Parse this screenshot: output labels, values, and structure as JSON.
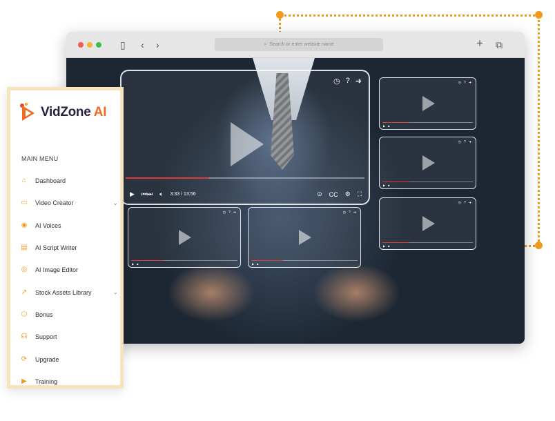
{
  "brand": {
    "name_main": "VidZone",
    "name_accent": "AI",
    "accent_color": "#f26a22"
  },
  "browser": {
    "address_placeholder": "Search or enter website name"
  },
  "player": {
    "time": "3:33 / 13:56",
    "cc": "CC",
    "progress": 0.35
  },
  "sidebar": {
    "section_title": "MAIN MENU",
    "items": [
      {
        "label": "Dashboard",
        "icon": "home-icon",
        "glyph": "⌂",
        "expand": ""
      },
      {
        "label": "Video Creator",
        "icon": "monitor-icon",
        "glyph": "▭",
        "expand": "⌄"
      },
      {
        "label": "AI Voices",
        "icon": "voice-icon",
        "glyph": "◉",
        "expand": ""
      },
      {
        "label": "AI Script Writer",
        "icon": "document-icon",
        "glyph": "▤",
        "expand": ""
      },
      {
        "label": "AI Image Editor",
        "icon": "image-edit-icon",
        "glyph": "◎",
        "expand": ""
      },
      {
        "label": "Stock Assets Library",
        "icon": "trend-icon",
        "glyph": "↗",
        "expand": "⌄"
      },
      {
        "label": "Bonus",
        "icon": "box-icon",
        "glyph": "⬡",
        "expand": ""
      },
      {
        "label": "Support",
        "icon": "support-icon",
        "glyph": "☊",
        "expand": ""
      },
      {
        "label": "Upgrade",
        "icon": "refresh-icon",
        "glyph": "⟳",
        "expand": ""
      },
      {
        "label": "Training",
        "icon": "video-icon",
        "glyph": "▶",
        "expand": ""
      }
    ]
  }
}
